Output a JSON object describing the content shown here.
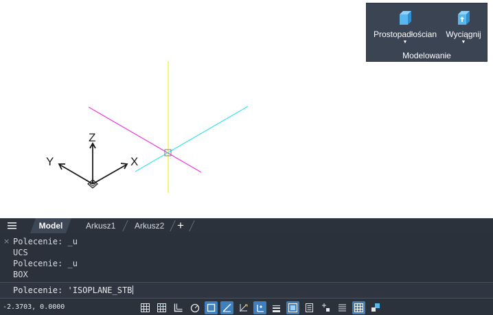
{
  "ribbon": {
    "buttons": [
      {
        "label": "Prostopadłościan",
        "icon": "box-icon"
      },
      {
        "label": "Wyciągnij",
        "icon": "extrude-icon"
      }
    ],
    "panel_title": "Modelowanie",
    "accent": "#59b7f0"
  },
  "canvas": {
    "ucs_labels": {
      "x": "X",
      "y": "Y",
      "z": "Z"
    },
    "axis_colors": {
      "x": "#33e5ee",
      "y": "#ee33dd",
      "z": "#f1ee2a"
    }
  },
  "tabs": {
    "menu_icon": "hamburger-menu-icon",
    "items": [
      "Model",
      "Arkusz1",
      "Arkusz2"
    ],
    "active": "Model",
    "add_label": "+"
  },
  "command": {
    "history": [
      "Polecenie: _u",
      "UCS",
      "Polecenie: _u",
      "BOX"
    ],
    "input": "Polecenie: 'ISOPLANE_STB",
    "close_icon": "×"
  },
  "status": {
    "coords": "-2.3703, 0.0000",
    "buttons": [
      {
        "icon": "grid-icon",
        "on": false
      },
      {
        "icon": "snap-grid-icon",
        "on": false
      },
      {
        "icon": "ortho-icon",
        "on": false
      },
      {
        "icon": "polar-tracking-icon",
        "on": false
      },
      {
        "icon": "object-snap-icon",
        "on": true
      },
      {
        "icon": "3d-object-snap-icon",
        "on": true
      },
      {
        "icon": "snap-tracking-icon",
        "on": false
      },
      {
        "icon": "dynamic-ucs-icon",
        "on": true
      },
      {
        "icon": "lineweight-icon",
        "on": false
      },
      {
        "icon": "transparency-icon",
        "on": true
      },
      {
        "icon": "quick-properties-icon",
        "on": false
      },
      {
        "icon": "selection-cycling-icon",
        "on": false
      },
      {
        "icon": "annotation-monitor-icon",
        "on": false
      },
      {
        "icon": "workspace-icon",
        "on": true
      },
      {
        "icon": "isolate-objects-icon",
        "on": false
      }
    ]
  }
}
